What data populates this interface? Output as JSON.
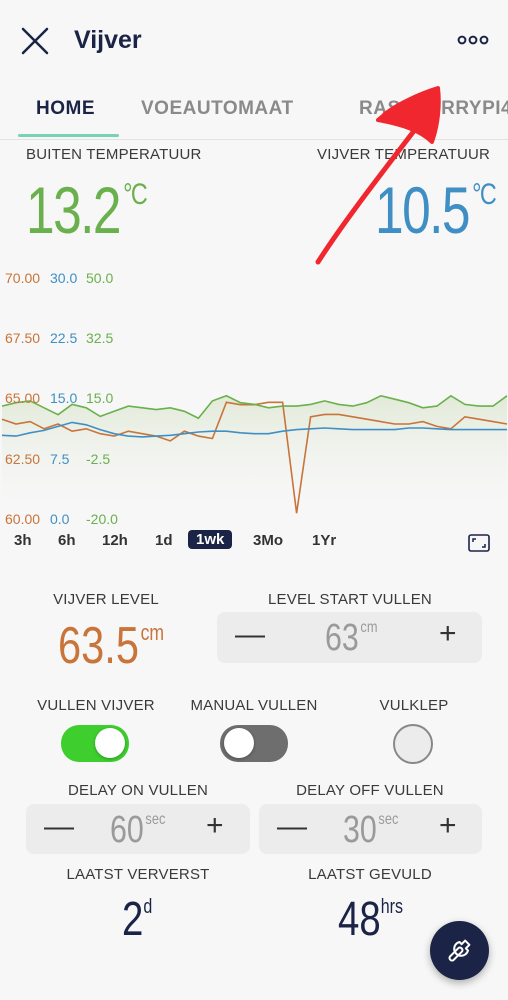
{
  "header": {
    "title": "Vijver",
    "close_icon": "close-icon",
    "more_icon": "more-icon"
  },
  "tabs": [
    {
      "label": "HOME",
      "active": true
    },
    {
      "label": "VOEAUTOMAAT",
      "active": false
    },
    {
      "label": "RASPBERRYPI4",
      "active": false
    }
  ],
  "temperatures": {
    "outside": {
      "label": "BUITEN TEMPERATUUR",
      "value": "13.2",
      "unit": "°C",
      "color": "#6ab04c"
    },
    "pond": {
      "label": "VIJVER TEMPERATUUR",
      "value": "10.5",
      "unit": "°C",
      "color": "#3f8fc4"
    }
  },
  "chart_data": {
    "type": "line",
    "x_range": "1wk",
    "axes": [
      {
        "color": "#c8743a",
        "ticks": [
          "70.00",
          "67.50",
          "65.00",
          "62.50",
          "60.00"
        ],
        "ylim": [
          60,
          70
        ]
      },
      {
        "color": "#3f8fc4",
        "ticks": [
          "30.0",
          "22.5",
          "15.0",
          "7.5",
          "0.0"
        ],
        "ylim": [
          0,
          30
        ]
      },
      {
        "color": "#6ab04c",
        "ticks": [
          "50.0",
          "32.5",
          "15.0",
          "-2.5",
          "-20.0"
        ],
        "ylim": [
          -20,
          50
        ]
      }
    ],
    "series": [
      {
        "color": "#c8743a",
        "values": [
          64.1,
          63.9,
          64.0,
          63.7,
          63.9,
          63.6,
          63.7,
          63.5,
          63.4,
          63.6,
          63.5,
          63.4,
          63.2,
          63.6,
          63.4,
          63.3,
          64.8,
          64.7,
          64.7,
          64.8,
          64.8,
          60.2,
          64.2,
          64.3,
          64.3,
          64.2,
          64.1,
          64.0,
          63.9,
          63.9,
          64.0,
          63.8,
          63.7,
          64.2,
          64.1,
          64.0,
          63.9
        ]
      },
      {
        "color": "#3f8fc4",
        "values": [
          10.3,
          10.2,
          10.6,
          10.9,
          11.4,
          11.9,
          11.6,
          11.0,
          10.5,
          10.2,
          10.1,
          10.2,
          10.3,
          10.5,
          10.7,
          10.8,
          10.8,
          10.6,
          10.5,
          10.5,
          10.8,
          11.0,
          11.1,
          11.2,
          11.1,
          11.0,
          11.0,
          11.0,
          11.0,
          11.2,
          11.2,
          11.1,
          11.0,
          11.0,
          11.0,
          11.0,
          11.0
        ]
      },
      {
        "color": "#6ab04c",
        "values": [
          12.5,
          13.5,
          14.0,
          12.0,
          10.0,
          13.0,
          12.0,
          9.5,
          11.0,
          12.5,
          12.0,
          11.5,
          12.0,
          11.0,
          9.0,
          14.0,
          15.5,
          13.5,
          13.0,
          12.0,
          12.5,
          12.5,
          13.0,
          14.0,
          13.0,
          12.5,
          13.5,
          15.5,
          14.5,
          13.5,
          12.0,
          12.5,
          15.5,
          13.0,
          12.5,
          12.5,
          15.5
        ]
      }
    ]
  },
  "ranges": [
    {
      "label": "3h",
      "active": false
    },
    {
      "label": "6h",
      "active": false
    },
    {
      "label": "12h",
      "active": false
    },
    {
      "label": "1d",
      "active": false
    },
    {
      "label": "1wk",
      "active": true
    },
    {
      "label": "3Mo",
      "active": false
    },
    {
      "label": "1Yr",
      "active": false
    }
  ],
  "level": {
    "label": "VIJVER LEVEL",
    "value": "63.5",
    "unit": "cm",
    "color": "#c8743a"
  },
  "level_start": {
    "label": "LEVEL START VULLEN",
    "value": "63",
    "unit": "cm",
    "minus": "—",
    "plus": "+"
  },
  "switches": {
    "vullen_vijver": {
      "label": "VULLEN VIJVER",
      "on": true
    },
    "manual_vullen": {
      "label": "MANUAL VULLEN",
      "on": false
    },
    "vulklep": {
      "label": "VULKLEP",
      "on": false
    }
  },
  "delay_on": {
    "label": "DELAY ON VULLEN",
    "value": "60",
    "unit": "sec",
    "minus": "—",
    "plus": "+"
  },
  "delay_off": {
    "label": "DELAY OFF VULLEN",
    "value": "30",
    "unit": "sec",
    "minus": "—",
    "plus": "+"
  },
  "last_refresh": {
    "label": "LAATST VERVERST",
    "value": "2",
    "unit": "d"
  },
  "last_filled": {
    "label": "LAATST GEVULD",
    "value": "48",
    "unit": "hrs"
  },
  "fab_icon": "wrench-icon",
  "colors": {
    "accent": "#79d2b4",
    "navy": "#1b2446",
    "toggle_on": "#3ecf2f",
    "annotation": "#f0272e"
  }
}
